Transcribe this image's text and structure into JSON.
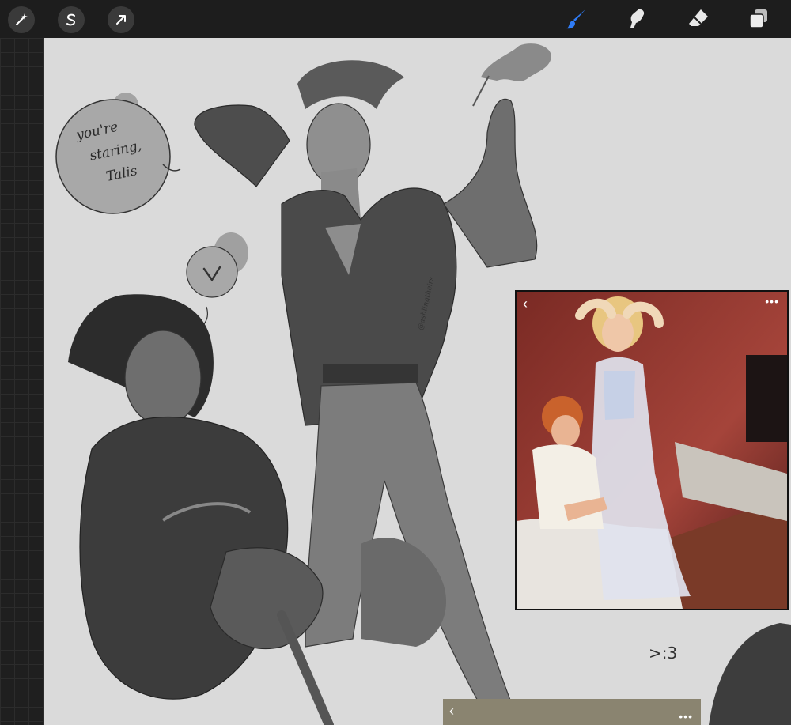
{
  "toolbar": {
    "left_tools": [
      {
        "name": "adjustments",
        "icon": "magic-wand-icon"
      },
      {
        "name": "selection",
        "icon": "selection-s-icon"
      },
      {
        "name": "transform",
        "icon": "arrow-cursor-icon"
      }
    ],
    "right_tools": [
      {
        "name": "brush",
        "icon": "brush-icon",
        "active": true
      },
      {
        "name": "smudge",
        "icon": "smudge-finger-icon"
      },
      {
        "name": "eraser",
        "icon": "eraser-icon"
      },
      {
        "name": "layers",
        "icon": "layers-icon"
      }
    ],
    "active_color": "#2f7cf6"
  },
  "canvas": {
    "speech_bubble_text": [
      "you're",
      "staring,",
      "Talis"
    ],
    "signature": "@ashlingtheirs",
    "emoticon": ">:3"
  },
  "reference": {
    "back_glyph": "‹",
    "more_glyph": "•••"
  },
  "reference2": {
    "back_glyph": "‹",
    "more_glyph": "•••"
  }
}
